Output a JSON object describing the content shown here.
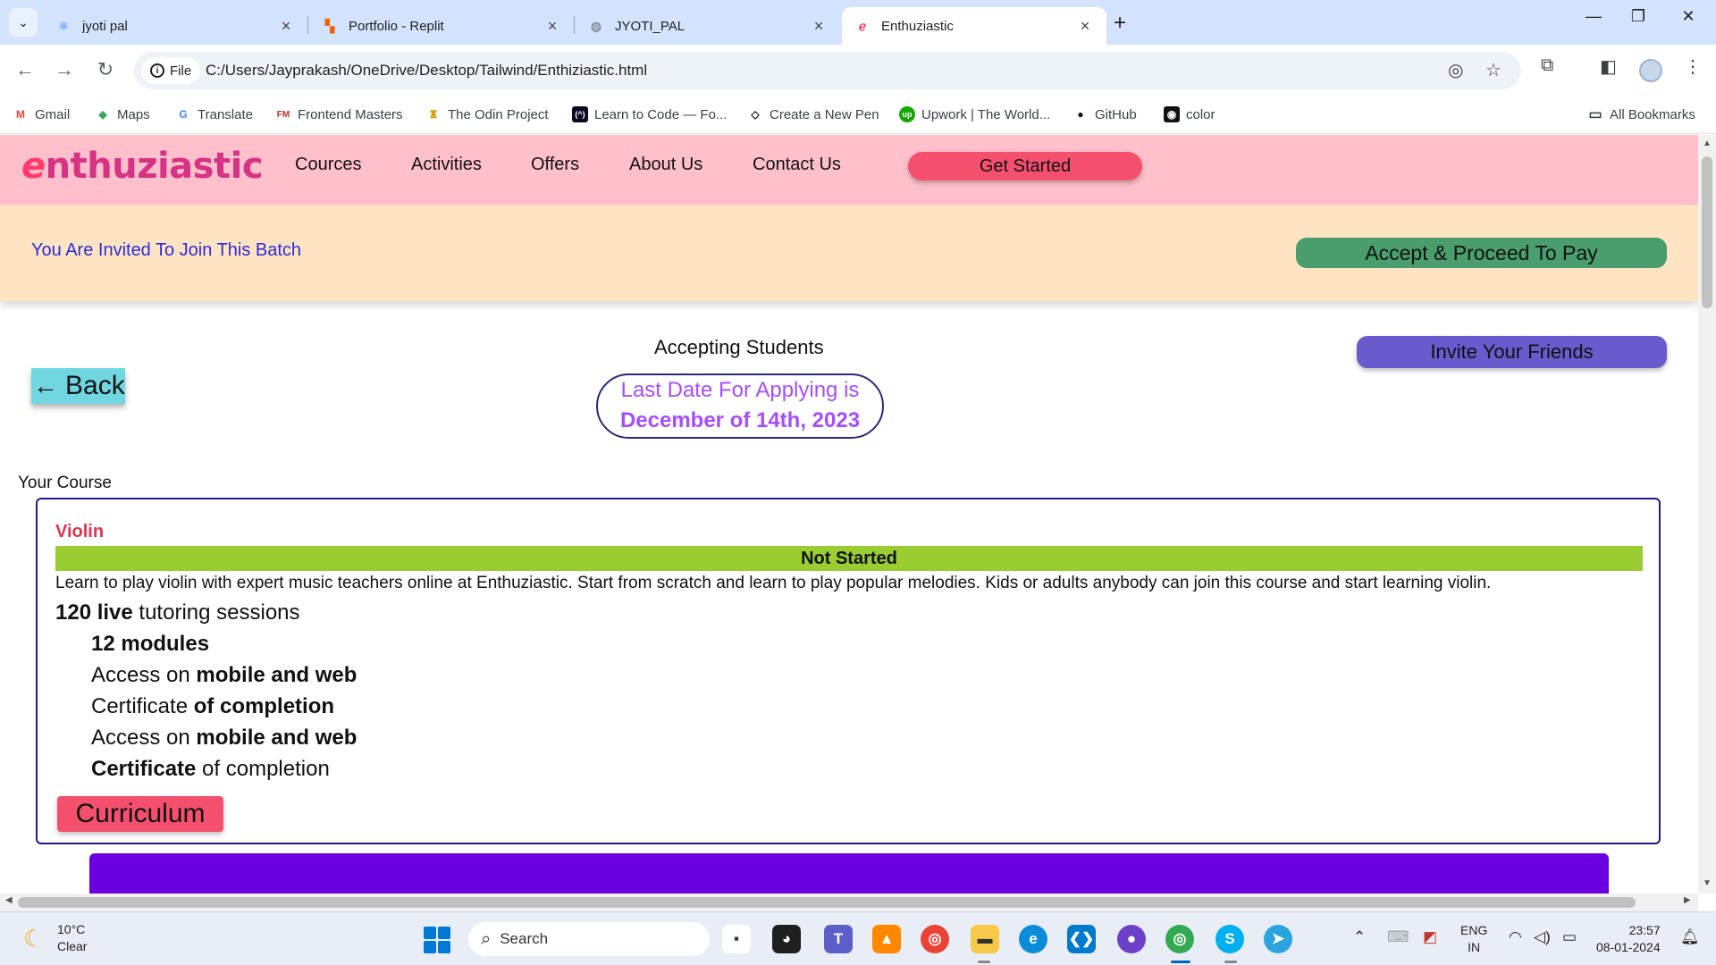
{
  "browser": {
    "tabs": [
      {
        "title": "jyoti pal",
        "icon": "react-icon",
        "active": false
      },
      {
        "title": "Portfolio - Replit",
        "icon": "replit-icon",
        "active": false
      },
      {
        "title": "JYOTI_PAL",
        "icon": "globe-icon",
        "active": false
      },
      {
        "title": "Enthuziastic",
        "icon": "enthuziastic-icon",
        "active": true
      }
    ],
    "new_tab": "+",
    "url_chip": "File",
    "url": "C:/Users/Jayprakash/OneDrive/Desktop/Tailwind/Enthiziastic.html",
    "bookmarks": [
      {
        "label": "Gmail",
        "icon": "gmail-icon",
        "color": "#ea4335",
        "glyph": "M"
      },
      {
        "label": "Maps",
        "icon": "maps-icon",
        "color": "#34a853",
        "glyph": "◆"
      },
      {
        "label": "Translate",
        "icon": "translate-icon",
        "color": "#4285f4",
        "glyph": "G"
      },
      {
        "label": "Frontend Masters",
        "icon": "frontend-masters-icon",
        "color": "#c02d28",
        "glyph": "FM"
      },
      {
        "label": "The Odin Project",
        "icon": "odin-icon",
        "color": "#d4a017",
        "glyph": "♜"
      },
      {
        "label": "Learn to Code — Fo...",
        "icon": "freecodecamp-icon",
        "color": "#0a0a23",
        "glyph": "(^)"
      },
      {
        "label": "Create a New Pen",
        "icon": "codepen-icon",
        "color": "#111111",
        "glyph": "◇"
      },
      {
        "label": "Upwork | The World...",
        "icon": "upwork-icon",
        "color": "#14a800",
        "glyph": "up"
      },
      {
        "label": "GitHub",
        "icon": "github-icon",
        "color": "#111111",
        "glyph": "●"
      },
      {
        "label": "color",
        "icon": "color-icon",
        "color": "#111111",
        "glyph": "◉"
      }
    ],
    "all_bookmarks": "All Bookmarks"
  },
  "site": {
    "logo": {
      "first": "e",
      "rest": "nthuziastic"
    },
    "nav": [
      "Cources",
      "Activities",
      "Offers",
      "About Us",
      "Contact Us"
    ],
    "get_started": "Get Started",
    "invite_text": "You Are Invited To Join This Batch",
    "accept_button": "Accept & Proceed To Pay",
    "accepting": "Accepting Students",
    "invite_friends": "Invite Your Friends",
    "back": "Back",
    "deadline_line1": "Last Date For Applying is",
    "deadline_line2": "December of 14th, 2023",
    "your_course": "Your Course",
    "course": {
      "name": "Violin",
      "status": "Not Started",
      "description": "Learn to play violin with expert music teachers online at Enthuziastic. Start from scratch and learn to play popular melodies. Kids or adults anybody can join this course and start learning violin.",
      "sessions_bold": "120 live",
      "sessions_rest": " tutoring sessions",
      "features": [
        {
          "normal_before": "",
          "bold": "12 modules",
          "normal_after": ""
        },
        {
          "normal_before": "Access on ",
          "bold": "mobile and web",
          "normal_after": ""
        },
        {
          "normal_before": "Certificate ",
          "bold": "of completion",
          "normal_after": ""
        },
        {
          "normal_before": "Access on ",
          "bold": "mobile and web",
          "normal_after": ""
        },
        {
          "normal_before": "",
          "bold": "Certificate",
          "normal_after": " of completion"
        }
      ],
      "curriculum": "Curriculum"
    },
    "colors": {
      "nav_bg": "#ffc0cb",
      "invite_bg": "#ffe4c4",
      "accent_pink": "#f4506e",
      "accept_green": "#4a9d6c",
      "invite_purple": "#6a5acd",
      "status_green": "#9acd32",
      "footer_purple": "#6a00e0"
    }
  },
  "taskbar": {
    "weather_temp": "10°C",
    "weather_desc": "Clear",
    "search": "Search",
    "lang1": "ENG",
    "lang2": "IN",
    "time": "23:57",
    "date": "08-01-2024"
  }
}
